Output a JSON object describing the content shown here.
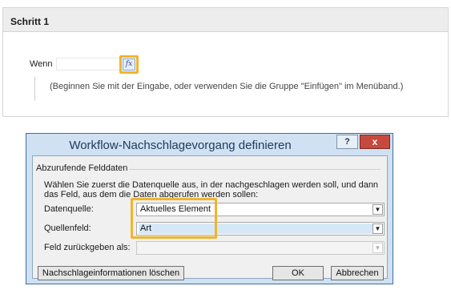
{
  "step": {
    "title": "Schritt 1",
    "condition_label": "Wenn",
    "fx_label": "fx",
    "hint": "(Beginnen Sie mit der Eingabe, oder verwenden Sie die Gruppe \"Einfügen\" im Menüband.)"
  },
  "dialog": {
    "title": "Workflow-Nachschlagevorgang definieren",
    "help_label": "?",
    "close_label": "x",
    "group_label": "Abzurufende Felddaten",
    "instruction": "Wählen Sie zuerst die Datenquelle aus, in der nachgeschlagen werden soll, und dann das Feld, aus dem die Daten abgerufen werden sollen:",
    "fields": {
      "datasource_label": "Datenquelle:",
      "datasource_value": "Aktuelles Element",
      "sourcefield_label": "Quellenfeld:",
      "sourcefield_value": "Art",
      "return_label": "Feld zurückgeben als:",
      "return_value": ""
    },
    "buttons": {
      "clear": "Nachschlageinformationen löschen",
      "ok": "OK",
      "cancel": "Abbrechen"
    }
  },
  "colors": {
    "highlight": "#f0b52c",
    "close_button": "#c7493d",
    "dialog_frame": "#cfe1f3"
  }
}
